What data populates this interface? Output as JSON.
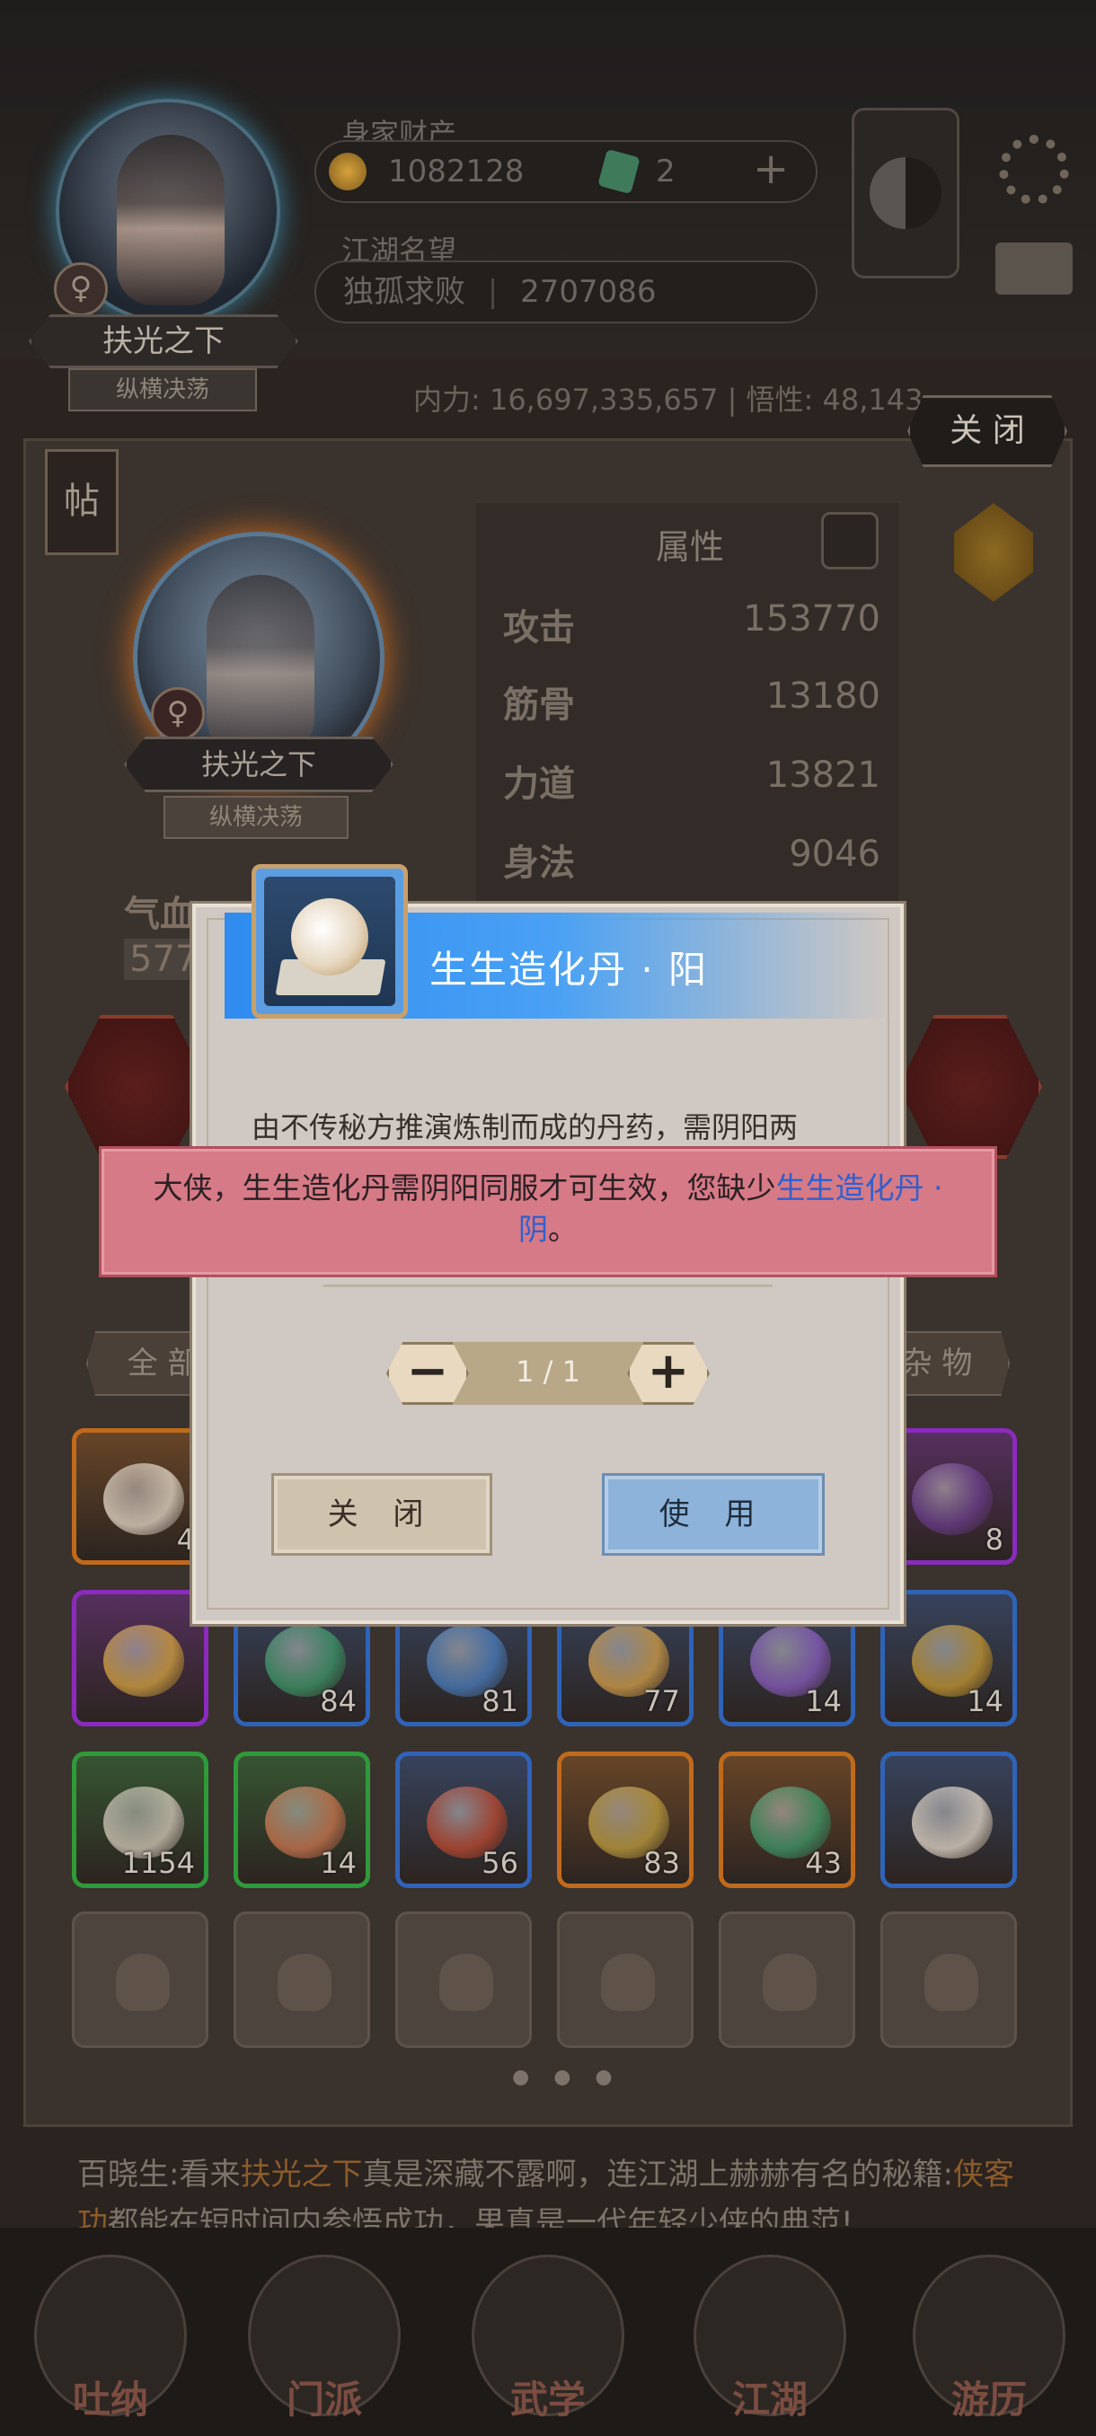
{
  "hud": {
    "assets_label": "身家财产",
    "coins": "1082128",
    "gems": "2",
    "fame_label": "江湖名望",
    "fame_title": "独孤求败",
    "fame_value": "2707086",
    "player_name": "扶光之下",
    "player_tag": "纵横决荡",
    "stats_line": "内力: 16,697,335,657 | 悟性: 48,143"
  },
  "panel": {
    "close_label": "关 闭",
    "tie_label": "帖",
    "portrait_name": "扶光之下",
    "portrait_tag": "纵横决荡",
    "gender_symbol": "♀",
    "attributes_title": "属性",
    "attributes": [
      {
        "key": "攻击",
        "value": "153770"
      },
      {
        "key": "筋骨",
        "value": "13180"
      },
      {
        "key": "力道",
        "value": "13821"
      },
      {
        "key": "身法",
        "value": "9046"
      }
    ],
    "qixue_label": "气血",
    "qixue_value": "577",
    "filter_all": "全 部",
    "filter_misc": "杂 物"
  },
  "inventory": {
    "row1": [
      {
        "count": "4",
        "color": "#c06a1c",
        "ball": "#e8dccb"
      },
      {
        "count": "8",
        "color": "#8a2bbd",
        "ball": "#6a3d8a"
      }
    ],
    "row2": [
      {
        "count": "",
        "color": "#8a2bbd",
        "ball": "#d9a640"
      },
      {
        "count": "84",
        "color": "#2f63b8",
        "ball": "#3e9a6a"
      },
      {
        "count": "81",
        "color": "#2f63b8",
        "ball": "#4a7fc0"
      },
      {
        "count": "77",
        "color": "#2f63b8",
        "ball": "#d8a24a"
      },
      {
        "count": "14",
        "color": "#2f63b8",
        "ball": "#8a5cc0"
      },
      {
        "count": "14",
        "color": "#2f63b8",
        "ball": "#c89a30"
      }
    ],
    "row3": [
      {
        "count": "1154",
        "color": "#2e9a3a",
        "ball": "#d8cdbd"
      },
      {
        "count": "14",
        "color": "#2e9a3a",
        "ball": "#d07850"
      },
      {
        "count": "56",
        "color": "#2f63b8",
        "ball": "#c04a30"
      },
      {
        "count": "83",
        "color": "#c06a1c",
        "ball": "#c0a040"
      },
      {
        "count": "43",
        "color": "#c06a1c",
        "ball": "#3e9a6a"
      },
      {
        "count": "",
        "color": "#2f63b8",
        "ball": "#e8dccb"
      }
    ]
  },
  "chat": {
    "prefix": "百晓生:看来",
    "name": "扶光之下",
    "middle": "真是深藏不露啊，连江湖上赫赫有名的秘籍:",
    "book": "侠客功",
    "suffix": "都能在短时间内参悟成功，果真是一代年轻少侠的典范!"
  },
  "nav": [
    "吐纳",
    "门派",
    "武学",
    "江湖",
    "游历"
  ],
  "dialog": {
    "title": "生生造化丹 · 阳",
    "description": "由不传秘方推演炼制而成的丹药，需阴阳两",
    "quantity": "1 / 1",
    "minus": "−",
    "plus": "+",
    "close_label": "关 闭",
    "use_label": "使 用"
  },
  "toast": {
    "message_prefix": "大侠，生生造化丹需阴阳同服才可生效，您缺少",
    "missing_item": "生生造化丹 · 阴",
    "message_suffix": "。"
  }
}
